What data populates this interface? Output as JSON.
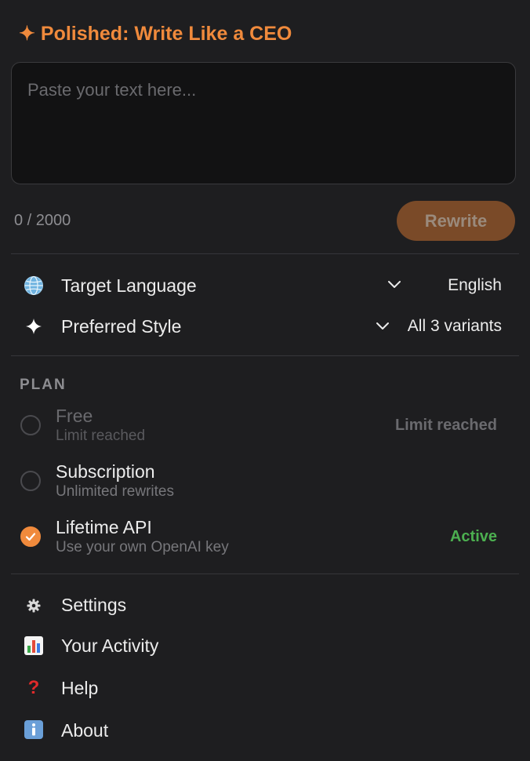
{
  "header": {
    "title": "✦ Polished: Write Like a CEO"
  },
  "editor": {
    "placeholder": "Paste your text here...",
    "value": "",
    "counter": "0 / 2000",
    "rewrite_label": "Rewrite"
  },
  "settings": {
    "target_language": {
      "label": "Target Language",
      "value": "English",
      "icon": "globe-icon"
    },
    "preferred_style": {
      "label": "Preferred Style",
      "value": "All 3 variants",
      "icon": "sparkle-icon"
    }
  },
  "plan": {
    "section_label": "PLAN",
    "options": [
      {
        "name": "Free",
        "subtitle": "Limit reached",
        "status": "Limit reached",
        "selected": false,
        "disabled": true
      },
      {
        "name": "Subscription",
        "subtitle": "Unlimited rewrites",
        "status": "",
        "selected": false,
        "disabled": false
      },
      {
        "name": "Lifetime API",
        "subtitle": "Use your own OpenAI key",
        "status": "Active",
        "selected": true,
        "disabled": false
      }
    ]
  },
  "menu": {
    "items": [
      {
        "label": "Settings",
        "icon": "gear-icon"
      },
      {
        "label": "Your Activity",
        "icon": "bar-chart-icon"
      },
      {
        "label": "Help",
        "icon": "question-icon"
      },
      {
        "label": "About",
        "icon": "info-icon"
      }
    ]
  },
  "colors": {
    "accent": "#f08a3c",
    "active": "#4caf50",
    "background": "#1e1e20"
  }
}
